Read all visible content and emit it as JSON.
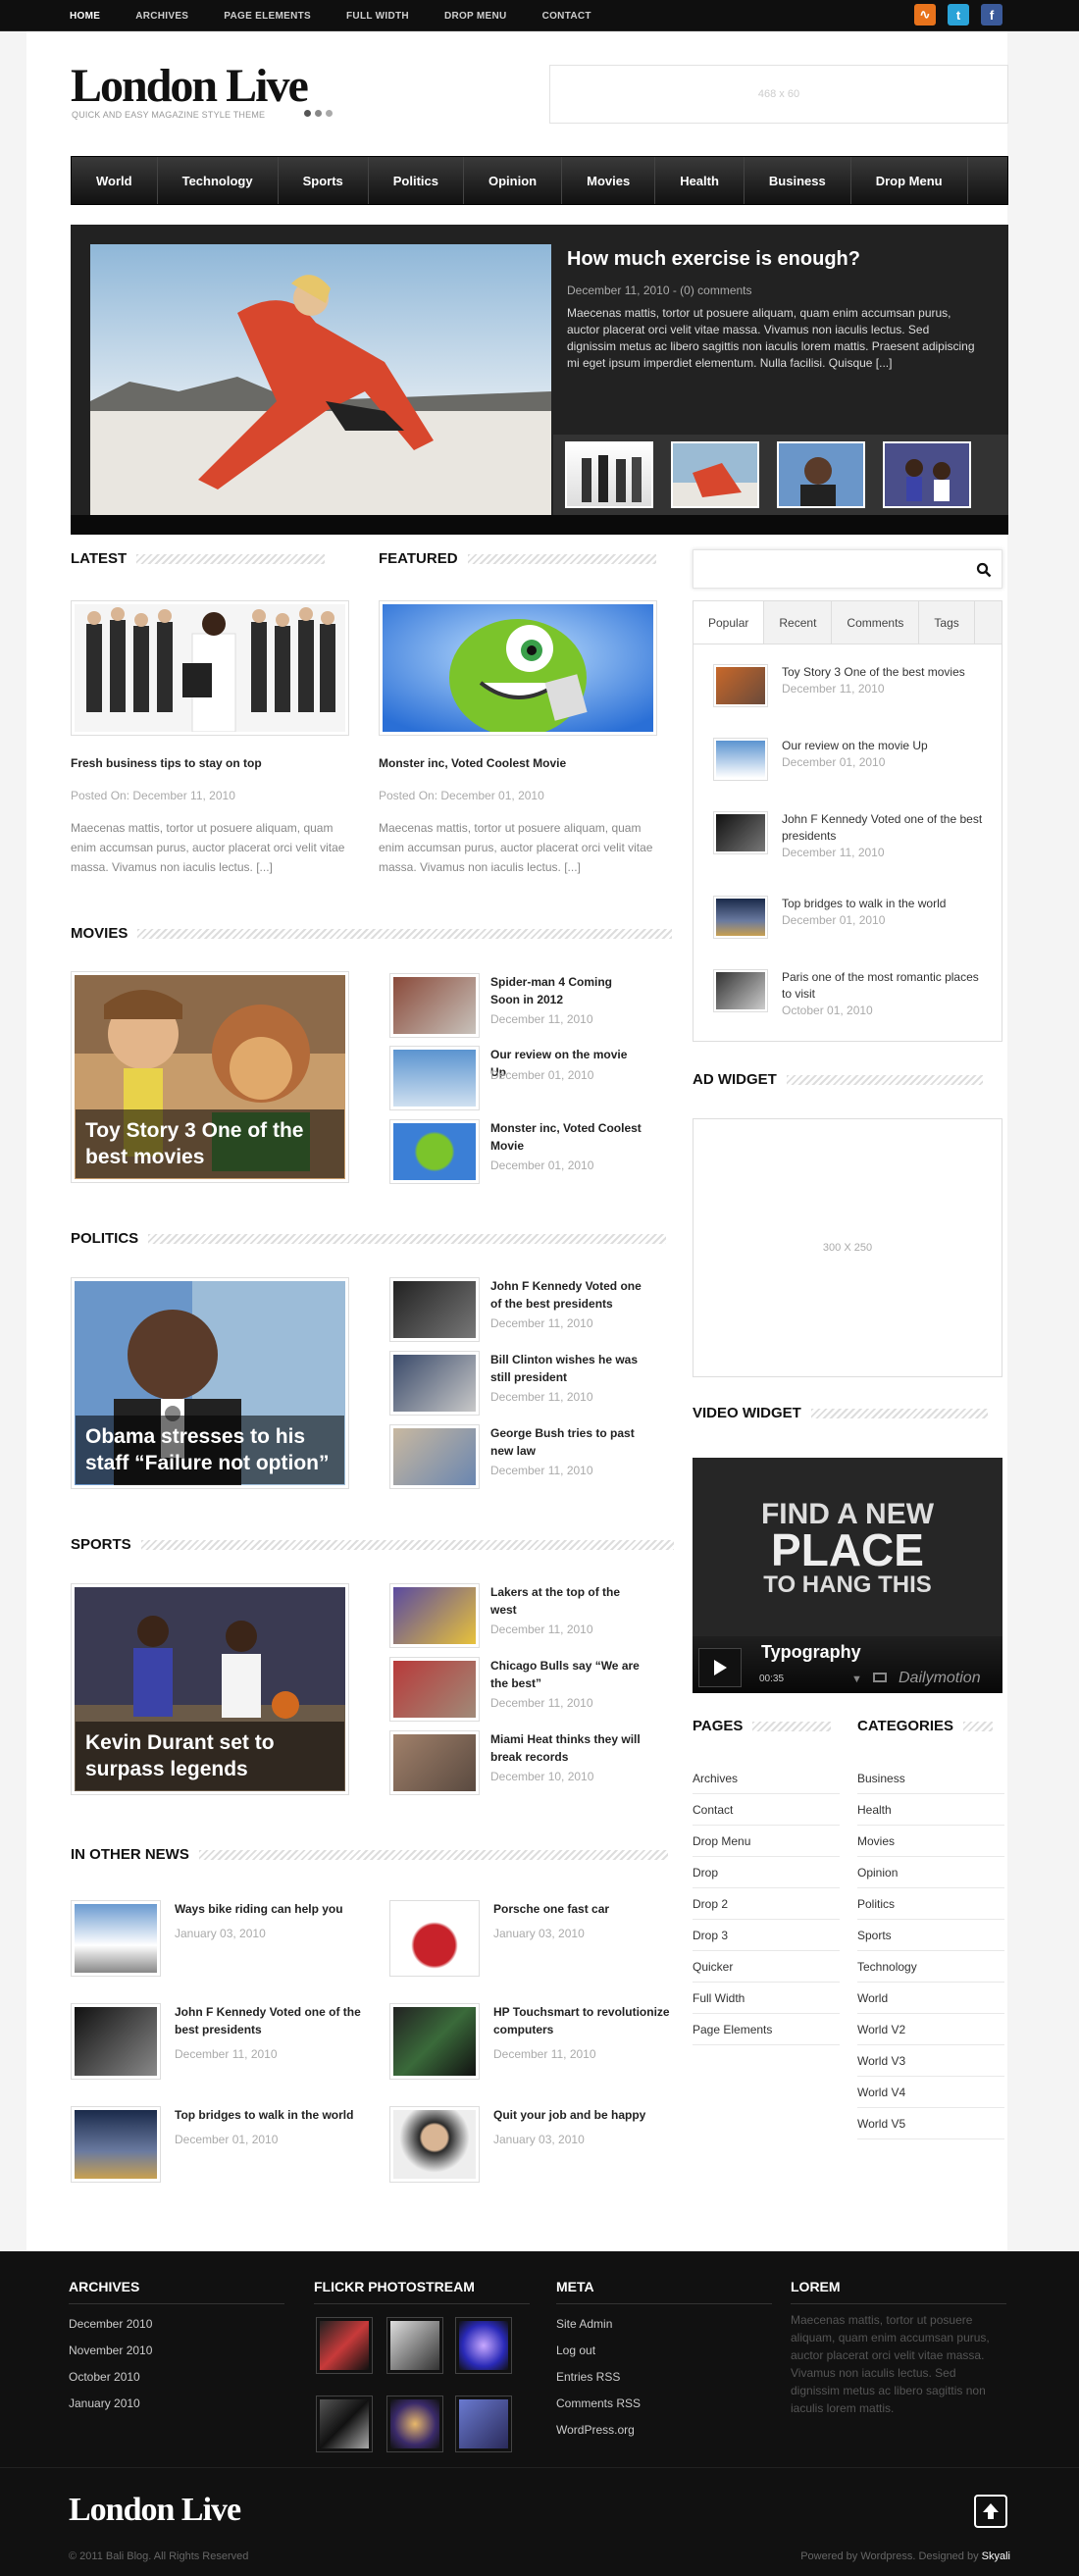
{
  "topnav": [
    "HOME",
    "ARCHIVES",
    "PAGE ELEMENTS",
    "FULL WIDTH",
    "DROP MENU",
    "CONTACT"
  ],
  "social": [
    "rss-icon",
    "twitter-icon",
    "facebook-icon"
  ],
  "brand": {
    "logo": "London Live",
    "tagline": "QUICK AND EASY MAGAZINE STYLE THEME"
  },
  "ad_top": "468 x 60",
  "mainnav": [
    "World",
    "Technology",
    "Sports",
    "Politics",
    "Opinion",
    "Movies",
    "Health",
    "Business",
    "Drop Menu"
  ],
  "slider": {
    "title": "How much exercise is enough?",
    "meta": "December 11, 2010 - (0) comments",
    "excerpt": "Maecenas mattis, tortor ut posuere aliquam, quam enim accumsan purus, auctor placerat orci velit vitae massa. Vivamus non iaculis lectus. Sed dignissim metus ac libero sagittis non iaculis lorem mattis. Praesent adipiscing mi eget ipsum imperdiet elementum. Nulla facilisi. Quisque [...]"
  },
  "latest": {
    "heading": "LATEST",
    "title": "Fresh business tips to stay on top",
    "meta": "Posted On: December 11, 2010",
    "excerpt": "Maecenas mattis, tortor ut posuere aliquam, quam enim accumsan purus, auctor placerat orci velit vitae massa. Vivamus non iaculis lectus. [...]"
  },
  "featured": {
    "heading": "FEATURED",
    "title": "Monster inc, Voted Coolest Movie",
    "meta": "Posted On: December 01, 2010",
    "excerpt": "Maecenas mattis, tortor ut posuere aliquam, quam enim accumsan purus, auctor placerat orci velit vitae massa. Vivamus non iaculis lectus. [...]"
  },
  "movies": {
    "heading": "MOVIES",
    "main": "Toy Story 3 One of the best movies",
    "items": [
      {
        "t": "Spider-man 4 Coming Soon in 2012",
        "d": "December 11, 2010"
      },
      {
        "t": "Our review on the movie Up",
        "d": "December 01, 2010"
      },
      {
        "t": "Monster inc, Voted Coolest Movie",
        "d": "December 01, 2010"
      }
    ]
  },
  "politics": {
    "heading": "POLITICS",
    "main": "Obama stresses to his staff “Failure not option”",
    "items": [
      {
        "t": "John F Kennedy Voted one of the best presidents",
        "d": "December 11, 2010"
      },
      {
        "t": "Bill Clinton wishes he was still president",
        "d": "December 11, 2010"
      },
      {
        "t": "George Bush tries to past new law",
        "d": "December 11, 2010"
      }
    ]
  },
  "sports": {
    "heading": "SPORTS",
    "main": "Kevin Durant set to surpass legends",
    "items": [
      {
        "t": "Lakers at the top of the west",
        "d": "December 11, 2010"
      },
      {
        "t": "Chicago Bulls say “We are the best”",
        "d": "December 11, 2010"
      },
      {
        "t": "Miami Heat thinks they will break records",
        "d": "December 10, 2010"
      }
    ]
  },
  "othernews": {
    "heading": "IN OTHER NEWS",
    "items": [
      {
        "t": "Ways bike riding can help you",
        "d": "January 03, 2010"
      },
      {
        "t": "Porsche one fast car",
        "d": "January 03, 2010"
      },
      {
        "t": "John F Kennedy Voted one of the best presidents",
        "d": "December 11, 2010"
      },
      {
        "t": "HP Touchsmart to revolutionize computers",
        "d": "December 11, 2010"
      },
      {
        "t": "Top bridges to walk in the world",
        "d": "December 01, 2010"
      },
      {
        "t": "Quit your job and be happy",
        "d": "January 03, 2010"
      }
    ]
  },
  "sidebar": {
    "tabs": [
      "Popular",
      "Recent",
      "Comments",
      "Tags"
    ],
    "popular": [
      {
        "t": "Toy Story 3 One of the best movies",
        "d": "December 11, 2010"
      },
      {
        "t": "Our review on the movie Up",
        "d": "December 01, 2010"
      },
      {
        "t": "John F Kennedy Voted one of the best presidents",
        "d": "December 11, 2010"
      },
      {
        "t": "Top bridges to walk in the world",
        "d": "December 01, 2010"
      },
      {
        "t": "Paris one of the most romantic places to visit",
        "d": "October 01, 2010"
      }
    ],
    "ad_heading": "AD WIDGET",
    "ad_text": "300 X 250",
    "video_heading": "VIDEO WIDGET",
    "video": {
      "line1": "FIND A NEW",
      "line2": "PLACE",
      "line3": "TO HANG THIS",
      "title": "Typography",
      "time": "00:35",
      "brand": "Dailymotion"
    },
    "pages_heading": "PAGES",
    "pages": [
      "Archives",
      "Contact",
      "Drop Menu",
      "Drop",
      "Drop 2",
      "Drop 3",
      "Quicker",
      "Full Width",
      "Page Elements"
    ],
    "cats_heading": "CATEGORIES",
    "cats": [
      "Business",
      "Health",
      "Movies",
      "Opinion",
      "Politics",
      "Sports",
      "Technology",
      "World",
      "World V2",
      "World V3",
      "World V4",
      "World V5"
    ]
  },
  "footer": {
    "archives_heading": "ARCHIVES",
    "archives": [
      "December 2010",
      "November 2010",
      "October 2010",
      "January 2010"
    ],
    "flickr_heading": "FLICKR PHOTOSTREAM",
    "meta_heading": "META",
    "meta": [
      "Site Admin",
      "Log out",
      "Entries RSS",
      "Comments RSS",
      "WordPress.org"
    ],
    "lorem_heading": "LOREM",
    "lorem": "Maecenas mattis, tortor ut posuere aliquam, quam enim accumsan purus, auctor placerat orci velit vitae massa. Vivamus non iaculis lectus. Sed dignissim metus ac libero sagittis non iaculis lorem mattis.",
    "logo": "London Live",
    "copy": "© 2011 Bali Blog. All Rights Reserved",
    "powered": "Powered by Wordpress. Designed by",
    "designer": "Skyali"
  }
}
